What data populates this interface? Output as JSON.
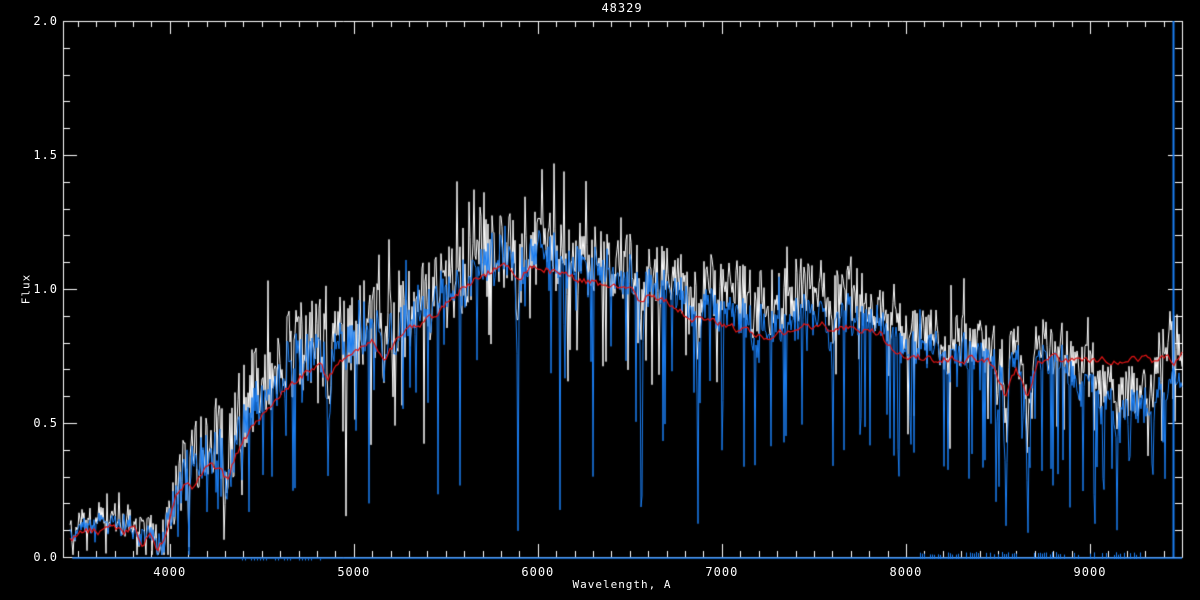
{
  "chart_data": {
    "type": "line",
    "title": "48329",
    "xlabel": "Wavelength, A",
    "ylabel": "Flux",
    "xlim": [
      3420,
      9500
    ],
    "ylim": [
      0.0,
      2.0
    ],
    "grid": false,
    "legend": null,
    "background_color": "#000000",
    "axis_color": "#ffffff",
    "x_ticks": {
      "major": [
        {
          "value": 4000,
          "label": "4000"
        },
        {
          "value": 5000,
          "label": "5000"
        },
        {
          "value": 6000,
          "label": "6000"
        },
        {
          "value": 7000,
          "label": "7000"
        },
        {
          "value": 8000,
          "label": "8000"
        },
        {
          "value": 9000,
          "label": "9000"
        }
      ],
      "minor_step": 100
    },
    "y_ticks": {
      "major": [
        {
          "value": 0.0,
          "label": "0.0"
        },
        {
          "value": 0.5,
          "label": "0.5"
        },
        {
          "value": 1.0,
          "label": "1.0"
        },
        {
          "value": 1.5,
          "label": "1.5"
        },
        {
          "value": 2.0,
          "label": "2.0"
        }
      ],
      "minor_step": 0.1
    },
    "noise_seed": 20240913,
    "data_start": 3458,
    "data_end": 9500,
    "series": [
      {
        "name": "observed-spectrum",
        "color": "#ffffff",
        "style": "noisy",
        "description": "white noisy observed flux trace"
      },
      {
        "name": "processed-spectrum",
        "color": "#1b7ef2",
        "style": "noisy",
        "description": "blue noisy trace overplotted, with deep absorption/artifact spikes and full-height artifact near 9450 A"
      },
      {
        "name": "template-fit",
        "color": "#e01414",
        "style": "smooth",
        "description": "red smooth template/fit curve",
        "points": [
          [
            3458,
            0.07
          ],
          [
            3520,
            0.09
          ],
          [
            3580,
            0.1
          ],
          [
            3640,
            0.09
          ],
          [
            3700,
            0.12
          ],
          [
            3750,
            0.08
          ],
          [
            3800,
            0.11
          ],
          [
            3850,
            0.05
          ],
          [
            3900,
            0.09
          ],
          [
            3930,
            0.03
          ],
          [
            3965,
            0.07
          ],
          [
            4000,
            0.14
          ],
          [
            4040,
            0.23
          ],
          [
            4090,
            0.27
          ],
          [
            4130,
            0.25
          ],
          [
            4180,
            0.31
          ],
          [
            4230,
            0.34
          ],
          [
            4280,
            0.31
          ],
          [
            4310,
            0.28
          ],
          [
            4360,
            0.38
          ],
          [
            4410,
            0.44
          ],
          [
            4460,
            0.5
          ],
          [
            4510,
            0.54
          ],
          [
            4560,
            0.58
          ],
          [
            4610,
            0.61
          ],
          [
            4660,
            0.64
          ],
          [
            4710,
            0.67
          ],
          [
            4760,
            0.7
          ],
          [
            4810,
            0.72
          ],
          [
            4860,
            0.66
          ],
          [
            4910,
            0.71
          ],
          [
            4960,
            0.75
          ],
          [
            5010,
            0.77
          ],
          [
            5060,
            0.79
          ],
          [
            5110,
            0.8
          ],
          [
            5170,
            0.74
          ],
          [
            5230,
            0.81
          ],
          [
            5290,
            0.84
          ],
          [
            5350,
            0.87
          ],
          [
            5410,
            0.89
          ],
          [
            5470,
            0.92
          ],
          [
            5530,
            0.96
          ],
          [
            5590,
            1.0
          ],
          [
            5650,
            1.03
          ],
          [
            5710,
            1.05
          ],
          [
            5770,
            1.08
          ],
          [
            5830,
            1.08
          ],
          [
            5890,
            1.02
          ],
          [
            5950,
            1.08
          ],
          [
            6000,
            1.09
          ],
          [
            6060,
            1.07
          ],
          [
            6120,
            1.06
          ],
          [
            6180,
            1.04
          ],
          [
            6250,
            1.03
          ],
          [
            6320,
            1.02
          ],
          [
            6390,
            1.02
          ],
          [
            6460,
            1.0
          ],
          [
            6530,
            0.99
          ],
          [
            6563,
            0.95
          ],
          [
            6600,
            0.98
          ],
          [
            6680,
            0.96
          ],
          [
            6760,
            0.93
          ],
          [
            6840,
            0.89
          ],
          [
            6920,
            0.89
          ],
          [
            7000,
            0.87
          ],
          [
            7080,
            0.85
          ],
          [
            7160,
            0.83
          ],
          [
            7240,
            0.82
          ],
          [
            7320,
            0.84
          ],
          [
            7400,
            0.86
          ],
          [
            7480,
            0.86
          ],
          [
            7560,
            0.87
          ],
          [
            7594,
            0.83
          ],
          [
            7650,
            0.86
          ],
          [
            7720,
            0.86
          ],
          [
            7800,
            0.85
          ],
          [
            7860,
            0.84
          ],
          [
            7900,
            0.79
          ],
          [
            7950,
            0.76
          ],
          [
            8000,
            0.75
          ],
          [
            8100,
            0.74
          ],
          [
            8200,
            0.74
          ],
          [
            8300,
            0.74
          ],
          [
            8400,
            0.73
          ],
          [
            8470,
            0.72
          ],
          [
            8542,
            0.6
          ],
          [
            8600,
            0.71
          ],
          [
            8662,
            0.59
          ],
          [
            8720,
            0.73
          ],
          [
            8800,
            0.74
          ],
          [
            8880,
            0.73
          ],
          [
            8960,
            0.74
          ],
          [
            9040,
            0.73
          ],
          [
            9120,
            0.74
          ],
          [
            9200,
            0.73
          ],
          [
            9280,
            0.74
          ],
          [
            9360,
            0.73
          ],
          [
            9420,
            0.74
          ],
          [
            9460,
            0.73
          ],
          [
            9500,
            0.77
          ]
        ]
      },
      {
        "name": "error-spectrum",
        "color": "#1b7ef2",
        "style": "flat-bottom",
        "description": "thin blue error/sky line running along the bottom axis",
        "level": 0.01
      }
    ],
    "continuum_points": [
      [
        3458,
        0.08
      ],
      [
        3500,
        0.1
      ],
      [
        3540,
        0.13
      ],
      [
        3580,
        0.12
      ],
      [
        3620,
        0.15
      ],
      [
        3660,
        0.11
      ],
      [
        3700,
        0.14
      ],
      [
        3740,
        0.1
      ],
      [
        3780,
        0.13
      ],
      [
        3820,
        0.09
      ],
      [
        3860,
        0.06
      ],
      [
        3900,
        0.11
      ],
      [
        3933,
        0.05
      ],
      [
        3970,
        0.1
      ],
      [
        4000,
        0.17
      ],
      [
        4050,
        0.26
      ],
      [
        4100,
        0.31
      ],
      [
        4150,
        0.35
      ],
      [
        4200,
        0.39
      ],
      [
        4250,
        0.41
      ],
      [
        4300,
        0.36
      ],
      [
        4350,
        0.44
      ],
      [
        4400,
        0.5
      ],
      [
        4450,
        0.56
      ],
      [
        4500,
        0.6
      ],
      [
        4550,
        0.64
      ],
      [
        4600,
        0.66
      ],
      [
        4650,
        0.69
      ],
      [
        4700,
        0.72
      ],
      [
        4750,
        0.75
      ],
      [
        4800,
        0.77
      ],
      [
        4860,
        0.7
      ],
      [
        4910,
        0.75
      ],
      [
        4960,
        0.79
      ],
      [
        5010,
        0.81
      ],
      [
        5060,
        0.83
      ],
      [
        5110,
        0.84
      ],
      [
        5170,
        0.79
      ],
      [
        5230,
        0.86
      ],
      [
        5290,
        0.88
      ],
      [
        5350,
        0.91
      ],
      [
        5410,
        0.93
      ],
      [
        5470,
        0.96
      ],
      [
        5530,
        1.0
      ],
      [
        5590,
        1.04
      ],
      [
        5650,
        1.07
      ],
      [
        5710,
        1.09
      ],
      [
        5770,
        1.12
      ],
      [
        5830,
        1.12
      ],
      [
        5890,
        1.06
      ],
      [
        5950,
        1.12
      ],
      [
        6000,
        1.13
      ],
      [
        6060,
        1.11
      ],
      [
        6120,
        1.1
      ],
      [
        6180,
        1.08
      ],
      [
        6250,
        1.07
      ],
      [
        6320,
        1.06
      ],
      [
        6390,
        1.06
      ],
      [
        6460,
        1.04
      ],
      [
        6530,
        1.03
      ],
      [
        6563,
        1.0
      ],
      [
        6600,
        1.02
      ],
      [
        6680,
        1.0
      ],
      [
        6760,
        0.97
      ],
      [
        6840,
        0.93
      ],
      [
        6920,
        0.93
      ],
      [
        7000,
        0.91
      ],
      [
        7080,
        0.89
      ],
      [
        7160,
        0.87
      ],
      [
        7240,
        0.86
      ],
      [
        7320,
        0.88
      ],
      [
        7400,
        0.9
      ],
      [
        7480,
        0.9
      ],
      [
        7560,
        0.91
      ],
      [
        7620,
        0.9
      ],
      [
        7700,
        0.9
      ],
      [
        7780,
        0.89
      ],
      [
        7860,
        0.88
      ],
      [
        7900,
        0.83
      ],
      [
        7950,
        0.8
      ],
      [
        8000,
        0.78
      ],
      [
        8080,
        0.77
      ],
      [
        8160,
        0.78
      ],
      [
        8240,
        0.77
      ],
      [
        8320,
        0.76
      ],
      [
        8400,
        0.75
      ],
      [
        8460,
        0.74
      ],
      [
        8542,
        0.68
      ],
      [
        8600,
        0.73
      ],
      [
        8662,
        0.66
      ],
      [
        8720,
        0.74
      ],
      [
        8800,
        0.73
      ],
      [
        8880,
        0.71
      ],
      [
        8960,
        0.68
      ],
      [
        9040,
        0.64
      ],
      [
        9120,
        0.6
      ],
      [
        9200,
        0.57
      ],
      [
        9280,
        0.57
      ],
      [
        9360,
        0.6
      ],
      [
        9420,
        0.63
      ],
      [
        9460,
        0.68
      ],
      [
        9500,
        0.63
      ]
    ],
    "noise_amplitude_points": [
      [
        3458,
        0.035
      ],
      [
        3700,
        0.04
      ],
      [
        3900,
        0.05
      ],
      [
        4000,
        0.09
      ],
      [
        4200,
        0.11
      ],
      [
        4400,
        0.12
      ],
      [
        4700,
        0.13
      ],
      [
        5000,
        0.13
      ],
      [
        5300,
        0.12
      ],
      [
        5600,
        0.12
      ],
      [
        6000,
        0.11
      ],
      [
        6400,
        0.1
      ],
      [
        6800,
        0.1
      ],
      [
        7200,
        0.1
      ],
      [
        7600,
        0.09
      ],
      [
        8000,
        0.075
      ],
      [
        8400,
        0.08
      ],
      [
        8800,
        0.08
      ],
      [
        9100,
        0.075
      ],
      [
        9500,
        0.07
      ]
    ],
    "white_offset_points": [
      [
        3458,
        0.01
      ],
      [
        4200,
        0.03
      ],
      [
        4400,
        0.06
      ],
      [
        4800,
        0.06
      ],
      [
        5100,
        0.03
      ],
      [
        5500,
        0.03
      ],
      [
        6000,
        0.03
      ],
      [
        6500,
        0.04
      ],
      [
        6800,
        0.07
      ],
      [
        7200,
        0.09
      ],
      [
        7600,
        0.09
      ],
      [
        7900,
        0.06
      ],
      [
        8200,
        0.04
      ],
      [
        8600,
        0.04
      ],
      [
        8900,
        0.06
      ],
      [
        9100,
        0.06
      ],
      [
        9300,
        0.04
      ],
      [
        9440,
        0.22
      ],
      [
        9500,
        0.05
      ]
    ],
    "spike_probability_points": [
      [
        3458,
        0.01
      ],
      [
        3900,
        0.02
      ],
      [
        4100,
        0.05
      ],
      [
        4600,
        0.06
      ],
      [
        5200,
        0.06
      ],
      [
        5800,
        0.06
      ],
      [
        6400,
        0.07
      ],
      [
        6900,
        0.08
      ],
      [
        7400,
        0.08
      ],
      [
        7900,
        0.09
      ],
      [
        8400,
        0.1
      ],
      [
        8900,
        0.1
      ],
      [
        9200,
        0.09
      ],
      [
        9500,
        0.08
      ]
    ],
    "spike_amplitude_points": [
      [
        3458,
        0.06
      ],
      [
        4000,
        0.2
      ],
      [
        4400,
        0.35
      ],
      [
        5000,
        0.45
      ],
      [
        5600,
        0.55
      ],
      [
        6200,
        0.6
      ],
      [
        6800,
        0.55
      ],
      [
        7400,
        0.5
      ],
      [
        7900,
        0.45
      ],
      [
        8450,
        0.55
      ],
      [
        8700,
        0.5
      ],
      [
        9000,
        0.45
      ],
      [
        9500,
        0.4
      ]
    ],
    "absorption_features": [
      {
        "lambda": 3933,
        "depth": 0.06,
        "width": 8
      },
      {
        "lambda": 3968,
        "depth": 0.05,
        "width": 8
      },
      {
        "lambda": 4101,
        "depth": 0.1,
        "width": 10
      },
      {
        "lambda": 4305,
        "depth": 0.09,
        "width": 12
      },
      {
        "lambda": 4340,
        "depth": 0.08,
        "width": 9
      },
      {
        "lambda": 4861,
        "depth": 0.18,
        "width": 9
      },
      {
        "lambda": 5172,
        "depth": 0.1,
        "width": 12
      },
      {
        "lambda": 5890,
        "depth": 0.25,
        "width": 9
      },
      {
        "lambda": 6563,
        "depth": 0.28,
        "width": 8
      },
      {
        "lambda": 6867,
        "depth": 0.22,
        "width": 10
      },
      {
        "lambda": 7186,
        "depth": 0.15,
        "width": 12
      },
      {
        "lambda": 7594,
        "depth": 0.25,
        "width": 11
      },
      {
        "lambda": 8227,
        "depth": 0.15,
        "width": 10
      },
      {
        "lambda": 8498,
        "depth": 0.15,
        "width": 8
      },
      {
        "lambda": 8542,
        "depth": 0.38,
        "width": 9
      },
      {
        "lambda": 8662,
        "depth": 0.38,
        "width": 9
      },
      {
        "lambda": 8940,
        "depth": 0.12,
        "width": 15
      },
      {
        "lambda": 9060,
        "depth": 0.1,
        "width": 12
      },
      {
        "lambda": 9150,
        "depth": 0.12,
        "width": 20
      },
      {
        "lambda": 9340,
        "depth": 0.12,
        "width": 12
      }
    ],
    "deep_spikes": [
      {
        "lambda": 4047,
        "floor": 0.28
      },
      {
        "lambda": 4250,
        "floor": 0.22
      },
      {
        "lambda": 4430,
        "floor": 0.2
      },
      {
        "lambda": 4680,
        "floor": 0.25
      },
      {
        "lambda": 4861,
        "floor": 0.3
      },
      {
        "lambda": 5085,
        "floor": 0.18
      },
      {
        "lambda": 5460,
        "floor": 0.22
      },
      {
        "lambda": 5577,
        "floor": 0.25
      },
      {
        "lambda": 5890,
        "floor": 0.09
      },
      {
        "lambda": 6123,
        "floor": 0.17
      },
      {
        "lambda": 6300,
        "floor": 0.3
      },
      {
        "lambda": 6563,
        "floor": 0.16
      },
      {
        "lambda": 6680,
        "floor": 0.42
      },
      {
        "lambda": 6870,
        "floor": 0.3
      },
      {
        "lambda": 7000,
        "floor": 0.38
      },
      {
        "lambda": 7180,
        "floor": 0.33
      },
      {
        "lambda": 7340,
        "floor": 0.42
      },
      {
        "lambda": 7605,
        "floor": 0.32
      },
      {
        "lambda": 7665,
        "floor": 0.38
      },
      {
        "lambda": 7750,
        "floor": 0.45
      },
      {
        "lambda": 7964,
        "floor": 0.3
      },
      {
        "lambda": 8025,
        "floor": 0.42
      },
      {
        "lambda": 8230,
        "floor": 0.32
      },
      {
        "lambda": 8345,
        "floor": 0.28
      },
      {
        "lambda": 8430,
        "floor": 0.35
      },
      {
        "lambda": 8505,
        "floor": 0.25
      },
      {
        "lambda": 8542,
        "floor": 0.1
      },
      {
        "lambda": 8662,
        "floor": 0.08
      },
      {
        "lambda": 8740,
        "floor": 0.35
      },
      {
        "lambda": 8825,
        "floor": 0.28
      },
      {
        "lambda": 8890,
        "floor": 0.18
      },
      {
        "lambda": 8960,
        "floor": 0.22
      },
      {
        "lambda": 9025,
        "floor": 0.12
      },
      {
        "lambda": 9075,
        "floor": 0.25
      },
      {
        "lambda": 9120,
        "floor": 0.3
      },
      {
        "lambda": 9220,
        "floor": 0.35
      },
      {
        "lambda": 9340,
        "floor": 0.28
      },
      {
        "lambda": 9395,
        "floor": 0.4
      }
    ],
    "edge_spike": {
      "lambda": 9452,
      "from": 0.0,
      "to": 2.0
    }
  }
}
